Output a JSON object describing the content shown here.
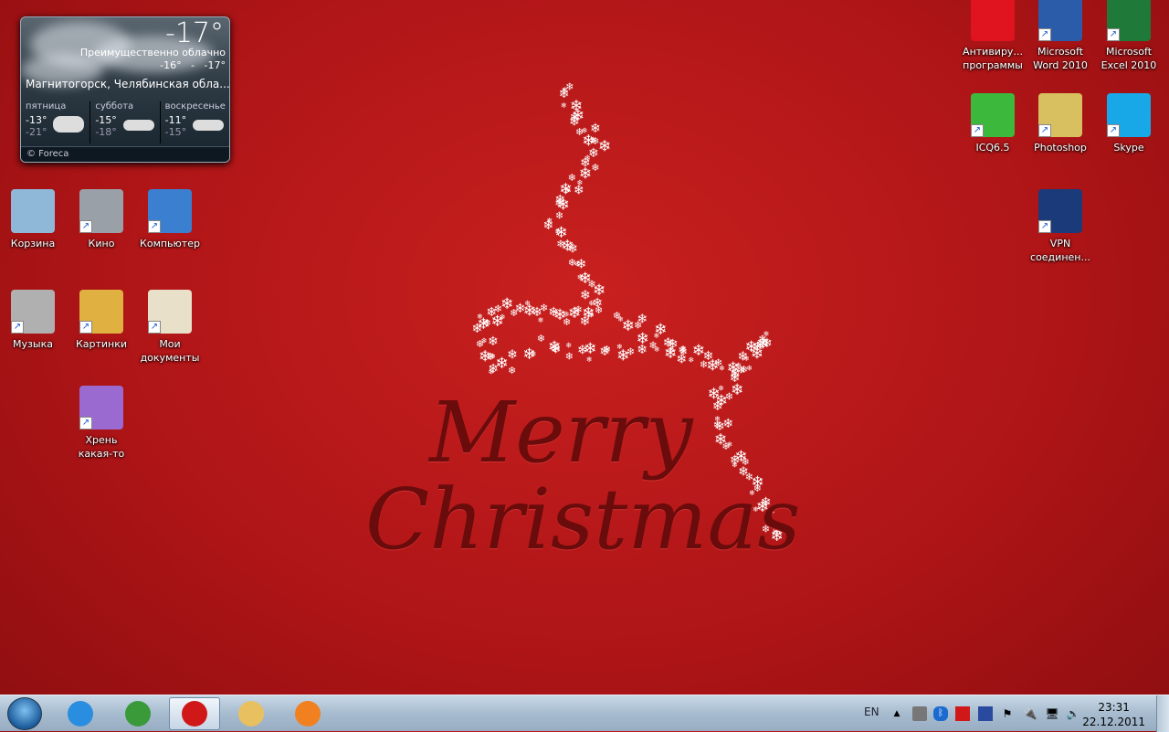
{
  "weather": {
    "temp": "-17°",
    "condition": "Преимущественно облачно",
    "range": "-16°   -   -17°",
    "city": "Магнитогорск, Челябинская обла...",
    "days": [
      {
        "name": "пятница",
        "hi": "-13°",
        "lo": "-21°"
      },
      {
        "name": "суббота",
        "hi": "-15°",
        "lo": "-18°"
      },
      {
        "name": "воскресенье",
        "hi": "-11°",
        "lo": "-15°"
      }
    ],
    "footer": "© Foreca"
  },
  "wallpaper": {
    "line1": "Merry",
    "line2": "Christmas"
  },
  "desktop_icons": [
    {
      "label": "Корзина",
      "icon": "recycle-bin-icon",
      "color": "#8fb8d8"
    },
    {
      "label": "Кино",
      "icon": "camcorder-icon",
      "color": "#9aa0a8"
    },
    {
      "label": "Компьютер",
      "icon": "computer-icon",
      "color": "#3a7fd0"
    },
    {
      "label": "Музыка",
      "icon": "speaker-icon",
      "color": "#b0b0b0"
    },
    {
      "label": "Картинки",
      "icon": "pictures-folder-icon",
      "color": "#e0b040"
    },
    {
      "label": "Мои документы",
      "icon": "clipboard-icon",
      "color": "#e8e0c8"
    },
    {
      "label": "Хрень какая-то",
      "icon": "floppy-icon",
      "color": "#9a6ad0"
    },
    {
      "label": "Антивиру... программы",
      "icon": "kaspersky-icon",
      "color": "#e0141e"
    },
    {
      "label": "Microsoft Word 2010",
      "icon": "word-icon",
      "color": "#2a5caa"
    },
    {
      "label": "Microsoft Excel 2010",
      "icon": "excel-icon",
      "color": "#1f7a3a"
    },
    {
      "label": "ICQ6.5",
      "icon": "icq-flower-icon",
      "color": "#3cb93c"
    },
    {
      "label": "Photoshop",
      "icon": "photoshop-icon",
      "color": "#d8c060"
    },
    {
      "label": "Skype",
      "icon": "skype-icon",
      "color": "#18a8e8"
    },
    {
      "label": "VPN соединен...",
      "icon": "vpn-icon",
      "color": "#1a3a7a"
    }
  ],
  "taskbar": {
    "apps": [
      {
        "name": "internet-explorer",
        "color": "#2a8ee0"
      },
      {
        "name": "chrome",
        "color": "#3a9a3a"
      },
      {
        "name": "opera-mail",
        "color": "#d01818"
      },
      {
        "name": "windows-explorer",
        "color": "#e8c060"
      },
      {
        "name": "media-player",
        "color": "#f08020"
      }
    ],
    "language": "EN",
    "time": "23:31",
    "date": "22.12.2011"
  }
}
